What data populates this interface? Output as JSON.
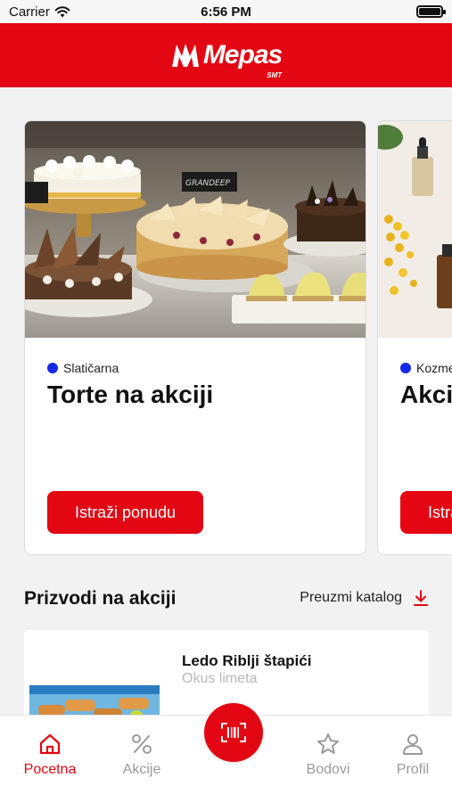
{
  "status_bar": {
    "carrier": "Carrier",
    "time": "6:56 PM"
  },
  "header": {
    "logo_text": "Mepas",
    "logo_sub": "SMT"
  },
  "carousel": {
    "cards": [
      {
        "category": "Slatičarna",
        "title": "Torte na akciji",
        "button_label": "Istraži ponudu"
      },
      {
        "category": "Kozmetika",
        "title": "Akcija na kozmetiku",
        "button_label": "Istraži ponudu"
      }
    ]
  },
  "deco": {
    "sign1": "GRAND",
    "sign2": "GRANDEEP"
  },
  "products_section": {
    "title": "Prizvodi na akciji",
    "catalog_label": "Preuzmi katalog"
  },
  "product": {
    "name": "Ledo Riblji štapići",
    "subtitle": "Okus limeta"
  },
  "tabbar": {
    "items": [
      {
        "label": "Pocetna",
        "icon": "home-icon",
        "active": true
      },
      {
        "label": "Akcije",
        "icon": "percent-icon",
        "active": false
      },
      {
        "label": "",
        "icon": "barcode-scan-icon",
        "active": false
      },
      {
        "label": "Bodovi",
        "icon": "star-icon",
        "active": false
      },
      {
        "label": "Profil",
        "icon": "user-icon",
        "active": false
      }
    ]
  },
  "colors": {
    "brand_red": "#e30613",
    "category_dot": "#1428e6",
    "background": "#f2f2f2"
  }
}
